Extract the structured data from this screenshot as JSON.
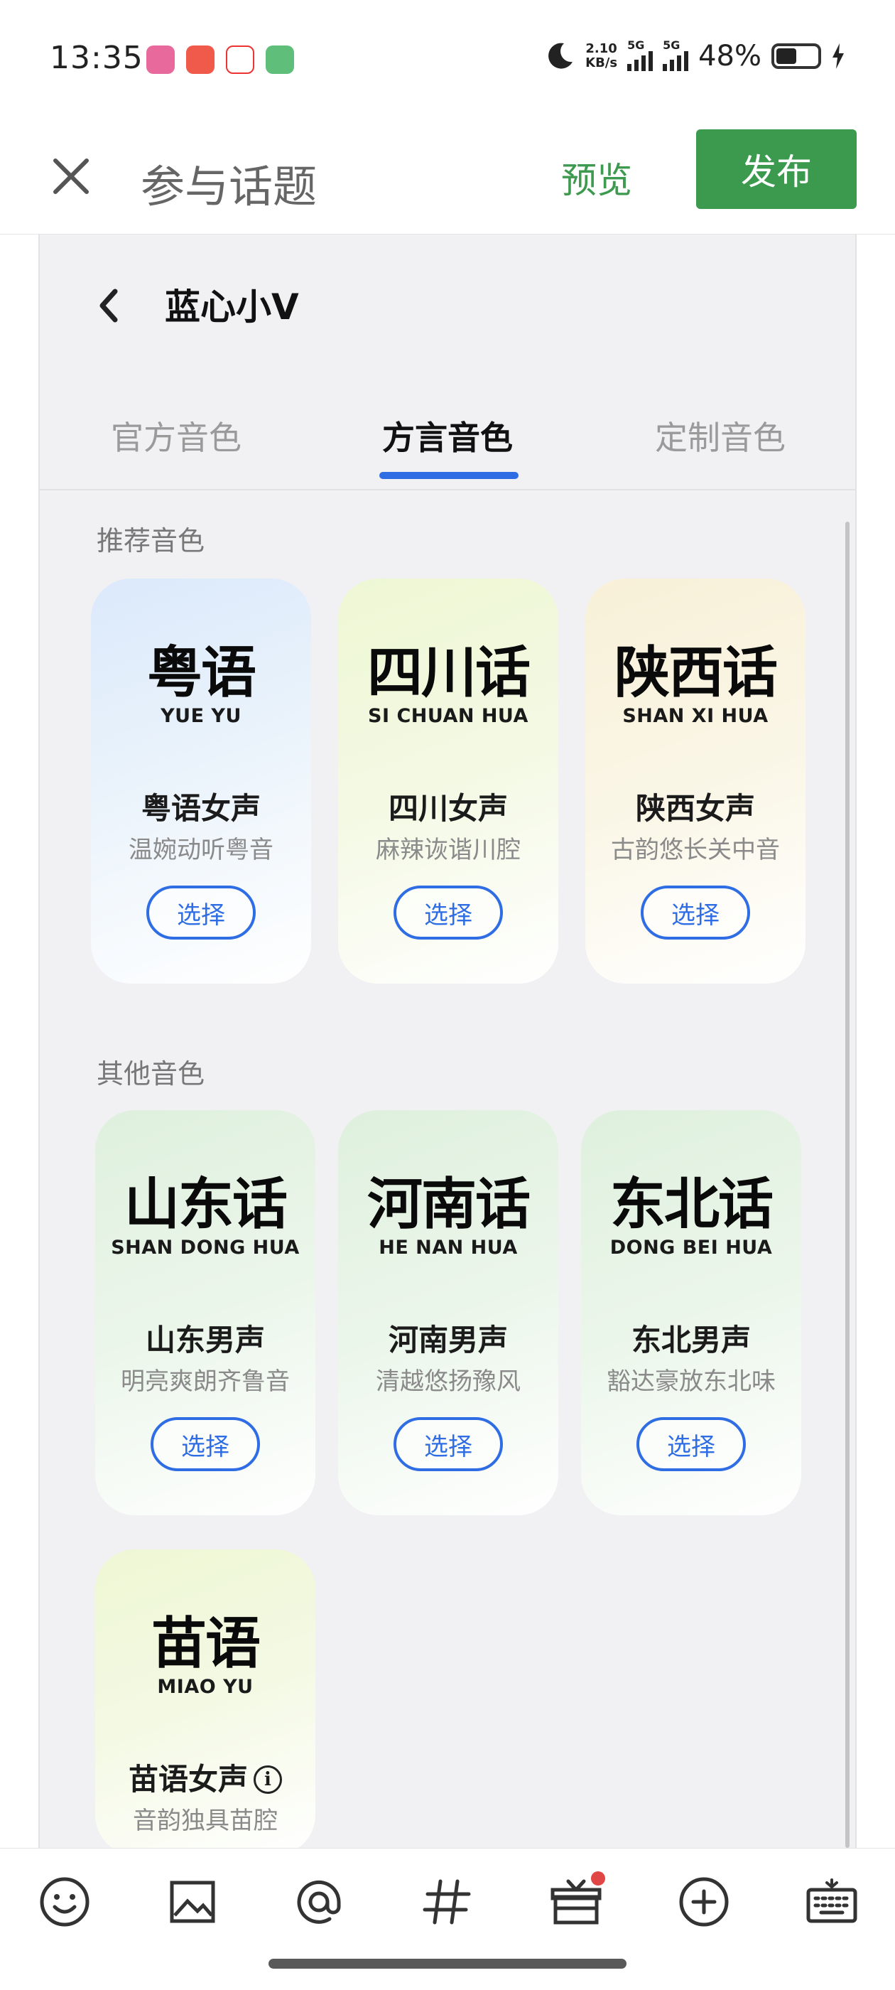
{
  "status_bar": {
    "time": "13:35",
    "net_speed": "2.10",
    "net_unit": "KB/s",
    "signal_tag_1": "5G",
    "signal_tag_2": "5G",
    "battery_text": "48%"
  },
  "header": {
    "title": "参与话题",
    "preview_label": "预览",
    "publish_label": "发布",
    "accent_green": "#3b9a4e"
  },
  "panel": {
    "title": "蓝心小V",
    "tabs": [
      {
        "label": "官方音色",
        "active": false
      },
      {
        "label": "方言音色",
        "active": true
      },
      {
        "label": "定制音色",
        "active": false
      }
    ],
    "accent_blue": "#2f6de4"
  },
  "sections": {
    "recommended_label": "推荐音色",
    "others_label": "其他音色"
  },
  "recommended": [
    {
      "glyphs": "粤语",
      "roman": "YUE YU",
      "name": "粤语女声",
      "desc": "温婉动听粤音",
      "button": "选择"
    },
    {
      "glyphs": "四川话",
      "roman": "SI CHUAN HUA",
      "name": "四川女声",
      "desc": "麻辣诙谐川腔",
      "button": "选择"
    },
    {
      "glyphs": "陕西话",
      "roman": "SHAN XI HUA",
      "name": "陕西女声",
      "desc": "古韵悠长关中音",
      "button": "选择"
    }
  ],
  "others": [
    {
      "glyphs": "山东话",
      "roman": "SHAN DONG HUA",
      "name": "山东男声",
      "desc": "明亮爽朗齐鲁音",
      "button": "选择"
    },
    {
      "glyphs": "河南话",
      "roman": "HE NAN HUA",
      "name": "河南男声",
      "desc": "清越悠扬豫风",
      "button": "选择"
    },
    {
      "glyphs": "东北话",
      "roman": "DONG BEI HUA",
      "name": "东北男声",
      "desc": "豁达豪放东北味",
      "button": "选择"
    },
    {
      "glyphs": "苗语",
      "roman": "MIAO YU",
      "name": "苗语女声",
      "desc": "音韵独具苗腔"
    }
  ],
  "toolbar_icons": [
    "emoji-icon",
    "image-icon",
    "mention-icon",
    "hashtag-icon",
    "gift-icon",
    "add-icon",
    "keyboard-icon"
  ]
}
